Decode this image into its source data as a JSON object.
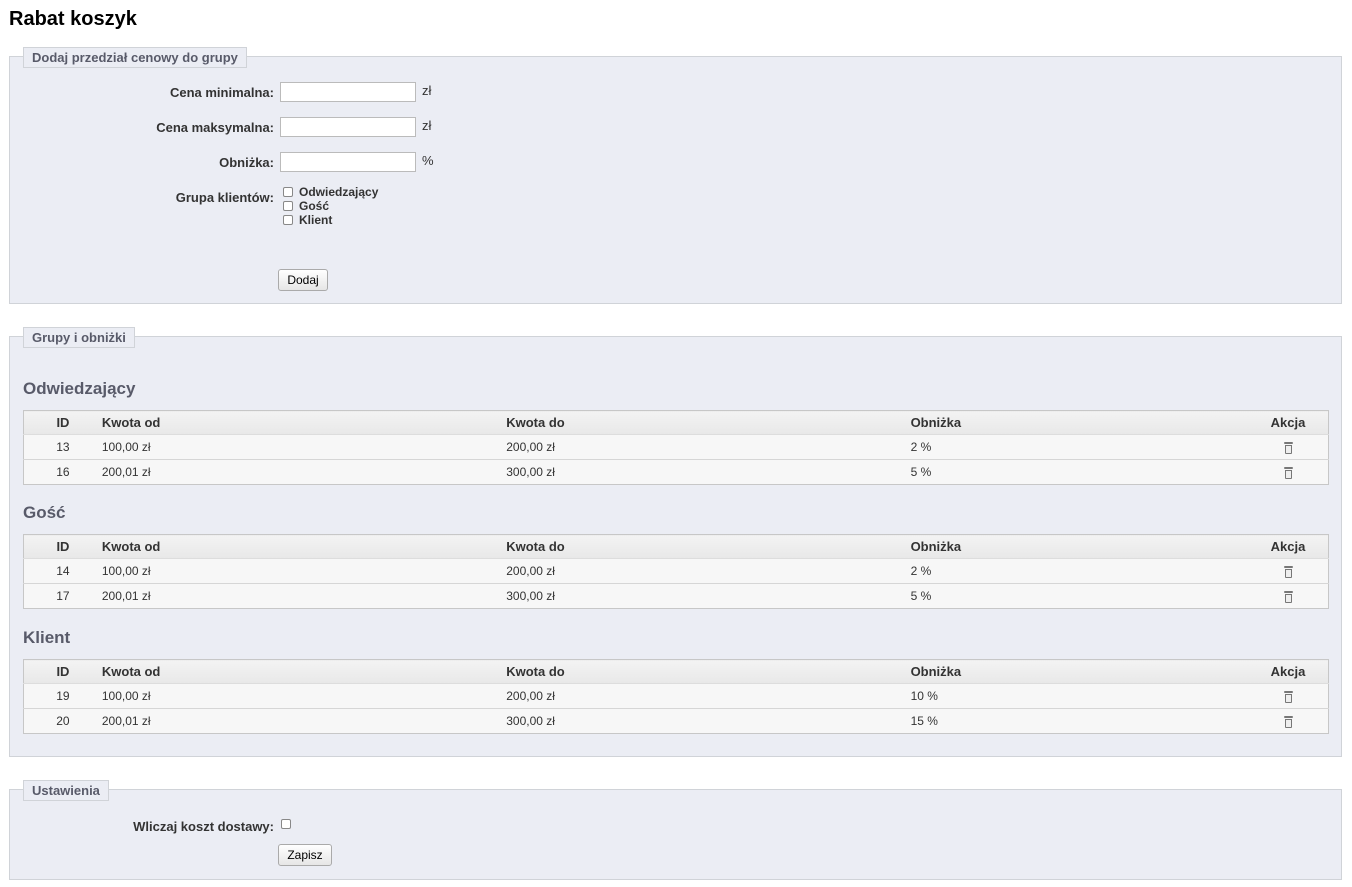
{
  "page_title": "Rabat koszyk",
  "add_section": {
    "legend": "Dodaj przedział cenowy do grupy",
    "min_price_label": "Cena minimalna:",
    "min_price_value": "",
    "max_price_label": "Cena maksymalna:",
    "max_price_value": "",
    "discount_label": "Obniżka:",
    "discount_value": "",
    "currency_unit": "zł",
    "percent_unit": "%",
    "customer_group_label": "Grupa klientów:",
    "customer_groups": [
      {
        "label": "Odwiedzający",
        "checked": false
      },
      {
        "label": "Gość",
        "checked": false
      },
      {
        "label": "Klient",
        "checked": false
      }
    ],
    "add_button": "Dodaj"
  },
  "groups_section": {
    "legend": "Grupy i obniżki",
    "columns": {
      "id": "ID",
      "from": "Kwota od",
      "to": "Kwota do",
      "discount": "Obniżka",
      "action": "Akcja"
    },
    "groups": [
      {
        "name": "Odwiedzający",
        "rows": [
          {
            "id": "13",
            "from": "100,00 zł",
            "to": "200,00 zł",
            "discount": "2 %",
            "action_icon": "trash-icon"
          },
          {
            "id": "16",
            "from": "200,01 zł",
            "to": "300,00 zł",
            "discount": "5 %",
            "action_icon": "trash-icon"
          }
        ]
      },
      {
        "name": "Gość",
        "rows": [
          {
            "id": "14",
            "from": "100,00 zł",
            "to": "200,00 zł",
            "discount": "2 %",
            "action_icon": "trash-icon"
          },
          {
            "id": "17",
            "from": "200,01 zł",
            "to": "300,00 zł",
            "discount": "5 %",
            "action_icon": "trash-icon"
          }
        ]
      },
      {
        "name": "Klient",
        "rows": [
          {
            "id": "19",
            "from": "100,00 zł",
            "to": "200,00 zł",
            "discount": "10 %",
            "action_icon": "trash-icon"
          },
          {
            "id": "20",
            "from": "200,01 zł",
            "to": "300,00 zł",
            "discount": "15 %",
            "action_icon": "trash-icon"
          }
        ]
      }
    ]
  },
  "settings_section": {
    "legend": "Ustawienia",
    "shipping_label": "Wliczaj koszt dostawy:",
    "shipping_checked": false,
    "save_button": "Zapisz"
  },
  "colors": {
    "fieldset_bg": "#ebedf4",
    "legend_text": "#585a69",
    "border": "#d0d3d8"
  }
}
